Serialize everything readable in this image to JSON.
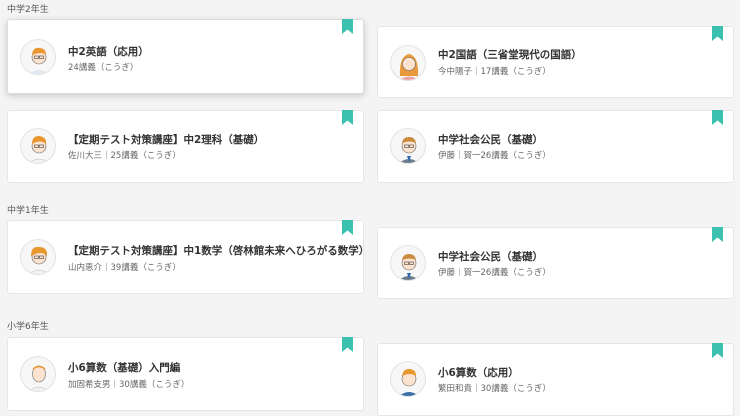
{
  "sections": [
    {
      "label": "中学2年生"
    },
    {
      "label": "中学1年生"
    },
    {
      "label": "小学6年生"
    }
  ],
  "cards": [
    {
      "title": "中2英語（応用）",
      "meta": "24講義（こうぎ）"
    },
    {
      "title": "中2国語（三省堂現代の国語）",
      "meta": "今中陽子｜17講義（こうぎ）"
    },
    {
      "title": "【定期テスト対策講座】中2理科（基礎）",
      "meta": "佐川大三｜25講義（こうぎ）"
    },
    {
      "title": "中学社会公民（基礎）",
      "meta": "伊藤｜賀一26講義（こうぎ）"
    },
    {
      "title": "【定期テスト対策講座】中1数学（啓林館未来へひろがる数学）",
      "meta": "山内恵介｜39講義（こうぎ）"
    },
    {
      "title": "中学社会公民（基礎）",
      "meta": "伊藤｜賀一26講義（こうぎ）"
    },
    {
      "title": "小6算数（基礎）入門編",
      "meta": "加固希支男｜30講義（こうぎ）"
    },
    {
      "title": "小6算数（応用）",
      "meta": "繁田和貴｜30講義（こうぎ）"
    }
  ],
  "colors": {
    "accent": "#3cc0b0"
  }
}
